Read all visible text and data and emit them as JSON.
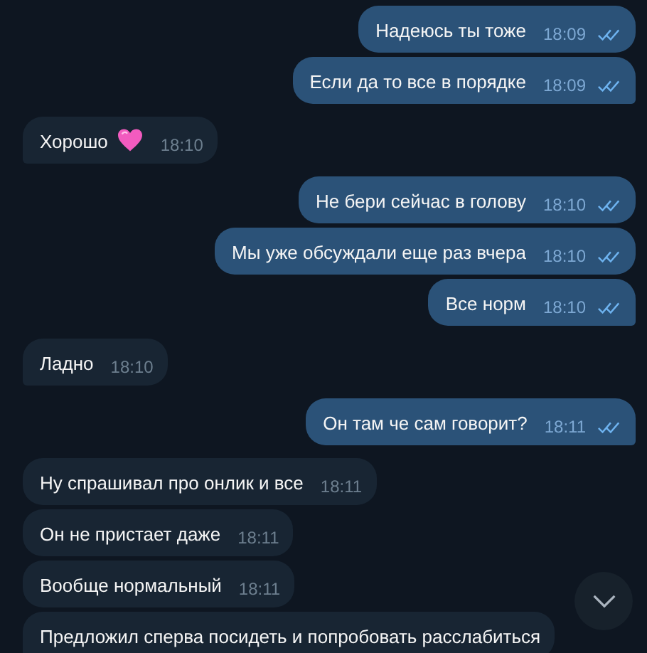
{
  "messages": [
    {
      "kind": "outgoing",
      "text": "Надеюсь ты тоже",
      "time": "18:09",
      "read": true
    },
    {
      "kind": "outgoing",
      "text": "Если да то все в порядке",
      "time": "18:09",
      "read": true
    },
    {
      "kind": "incoming",
      "text": "Хорошо",
      "emoji": {
        "kind": "heart"
      },
      "time": "18:10"
    },
    {
      "kind": "outgoing",
      "text": "Не бери сейчас в голову",
      "time": "18:10",
      "read": true
    },
    {
      "kind": "outgoing",
      "text": "Мы уже обсуждали еще раз вчера",
      "time": "18:10",
      "read": true
    },
    {
      "kind": "outgoing",
      "text": "Все норм",
      "time": "18:10",
      "read": true
    },
    {
      "kind": "incoming",
      "text": "Ладно",
      "time": "18:10"
    },
    {
      "kind": "outgoing",
      "text": "Он там че сам говорит?",
      "time": "18:11",
      "read": true
    },
    {
      "kind": "incoming",
      "text": "Ну спрашивал про онлик и все",
      "time": "18:11"
    },
    {
      "kind": "incoming",
      "text": "Он не пристает даже",
      "time": "18:11"
    },
    {
      "kind": "incoming",
      "text": "Вообще нормальный",
      "time": "18:11"
    },
    {
      "kind": "incoming",
      "text": "Предложил сперва посидеть и попробовать расслабиться"
    }
  ]
}
